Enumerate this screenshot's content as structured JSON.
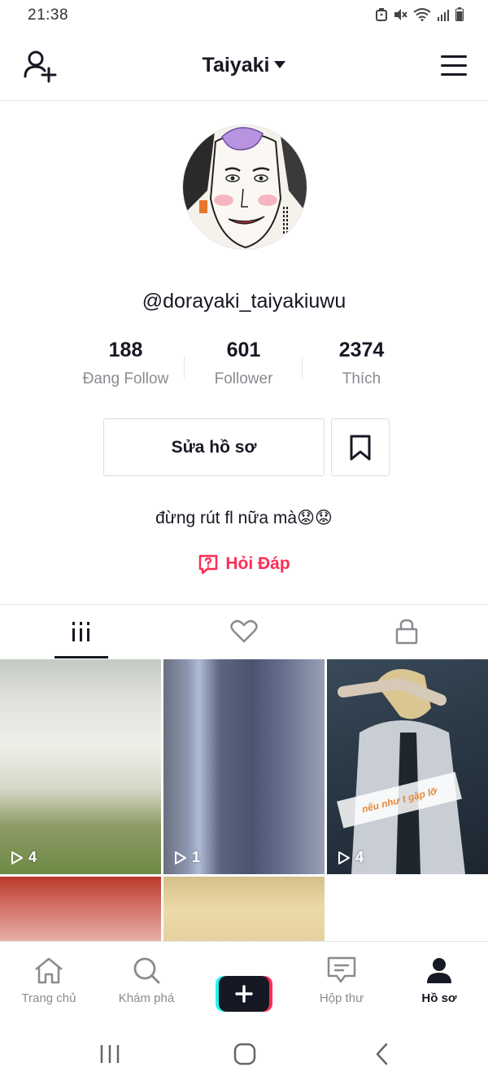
{
  "status_bar": {
    "time": "21:38"
  },
  "header": {
    "title": "Taiyaki"
  },
  "profile": {
    "username": "@dorayaki_taiyakiuwu",
    "stats": [
      {
        "value": "188",
        "label": "Đang Follow"
      },
      {
        "value": "601",
        "label": "Follower"
      },
      {
        "value": "2374",
        "label": "Thích"
      }
    ],
    "edit_button": "Sửa hồ sơ",
    "bio": "đừng rút fl nữa mà😟😟",
    "qa_link": "Hỏi Đáp"
  },
  "videos": [
    {
      "views": "4"
    },
    {
      "views": "1"
    },
    {
      "views": "4",
      "caption": "nếu như t gặp lỡ"
    }
  ],
  "bottom_nav": {
    "items": [
      {
        "label": "Trang chủ"
      },
      {
        "label": "Khám phá"
      },
      {
        "label": ""
      },
      {
        "label": "Hộp thư"
      },
      {
        "label": "Hồ sơ"
      }
    ]
  },
  "colors": {
    "accent": "#fe2c55",
    "text": "#161823",
    "muted": "#8a8b91",
    "plus_cyan": "#25f4ee"
  }
}
